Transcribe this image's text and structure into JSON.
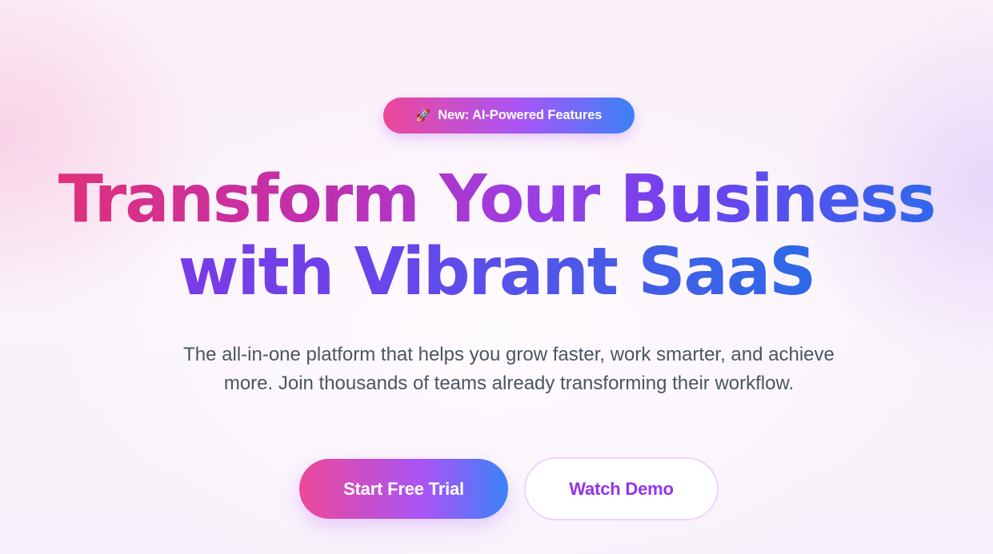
{
  "badge": {
    "icon": "rocket-icon",
    "icon_glyph": "🚀",
    "label": "New: AI-Powered Features"
  },
  "headline": {
    "line1": "Transform Your Business",
    "line2": "with Vibrant SaaS"
  },
  "subtitle": "The all-in-one platform that helps you grow faster, work smarter, and achieve more. Join thousands of teams already transforming their workflow.",
  "cta": {
    "primary_label": "Start Free Trial",
    "secondary_label": "Watch Demo"
  },
  "colors": {
    "pink": "#ec4899",
    "purple": "#a855f7",
    "blue": "#3b82f6",
    "secondary_text": "#9333ea",
    "body_text": "#4b5563"
  }
}
